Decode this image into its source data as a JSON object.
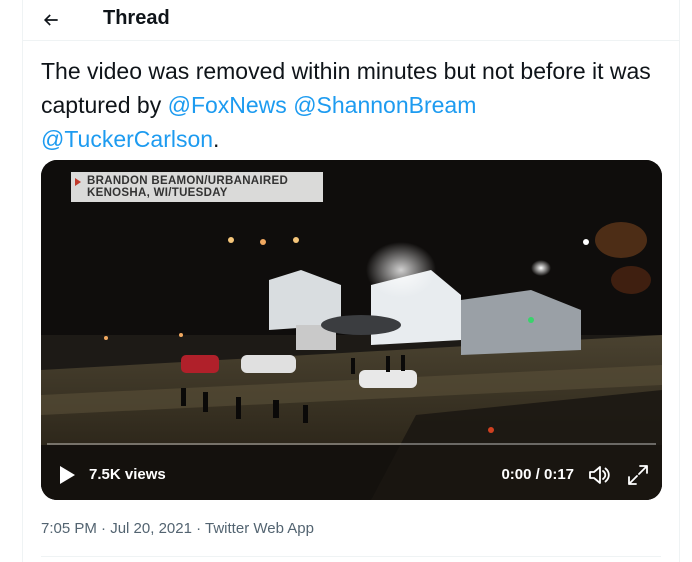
{
  "header": {
    "title": "Thread",
    "back_icon": "arrow-left-icon"
  },
  "tweet": {
    "text_before": "The video was removed within minutes but not before it was captured by ",
    "mentions": [
      "@FoxNews",
      "@ShannonBream",
      "@TuckerCarlson"
    ],
    "text_after": "."
  },
  "video": {
    "chyron_line1": "BRANDON BEAMON/URBANAIRED",
    "chyron_line2": "KENOSHA, WI/TUESDAY",
    "views": "7.5K views",
    "time": "0:00 / 0:17",
    "progress": 0,
    "icons": [
      "play-icon",
      "volume-icon",
      "fullscreen-icon"
    ]
  },
  "meta": {
    "time": "7:05 PM",
    "date": "Jul 20, 2021",
    "app": "Twitter Web App",
    "separator": " · "
  },
  "colors": {
    "accent": "#1d9bf0",
    "text": "#0f1419",
    "secondary": "#536471"
  }
}
